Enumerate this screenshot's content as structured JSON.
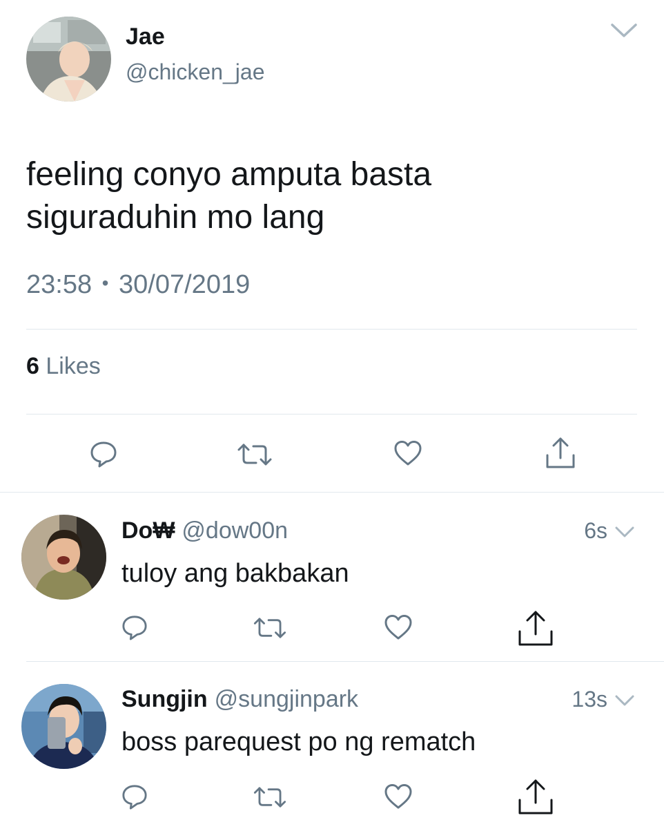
{
  "tweet": {
    "author_name": "Jae",
    "author_handle": "@chicken_jae",
    "text_line1": "feeling conyo amputa basta",
    "text_line2": "siguraduhin mo lang",
    "time": "23:58",
    "separator": "•",
    "date": "30/07/2019",
    "likes_count": "6",
    "likes_label": "Likes"
  },
  "replies": [
    {
      "author_name": "Do₩",
      "author_handle": "@dow00n",
      "time": "6s",
      "text": "tuloy ang bakbakan"
    },
    {
      "author_name": "Sungjin",
      "author_handle": "@sungjinpark",
      "time": "13s",
      "text": "boss parequest po ng rematch"
    }
  ],
  "icons": {
    "menu": "chevron-down-icon",
    "reply": "reply-icon",
    "retweet": "retweet-icon",
    "like": "heart-icon",
    "share": "share-icon"
  },
  "colors": {
    "text": "#14171a",
    "secondary": "#657786",
    "divider": "#e1e8ed"
  }
}
